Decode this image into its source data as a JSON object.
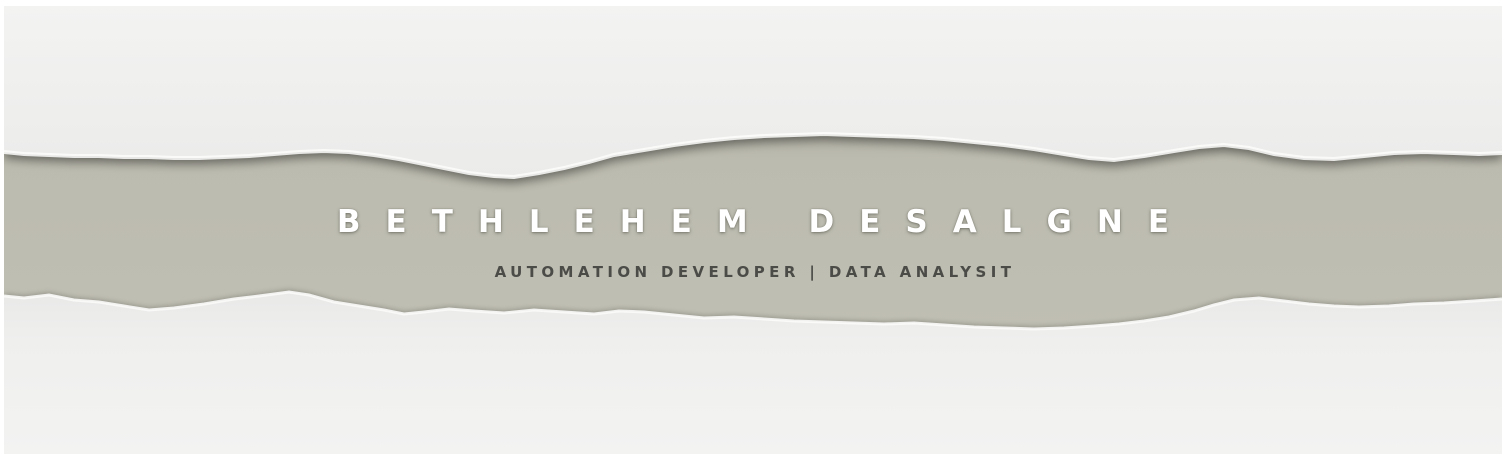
{
  "banner": {
    "name": "BETHLEHEM DESALGNE",
    "subtitle": "AUTOMATION DEVELOPER | DATA ANALYSIT"
  },
  "colors": {
    "gap": "#bdbcb0",
    "paper": "#f1f1f0",
    "name_text": "#ffffff",
    "subtitle_text": "#4b4b48"
  }
}
